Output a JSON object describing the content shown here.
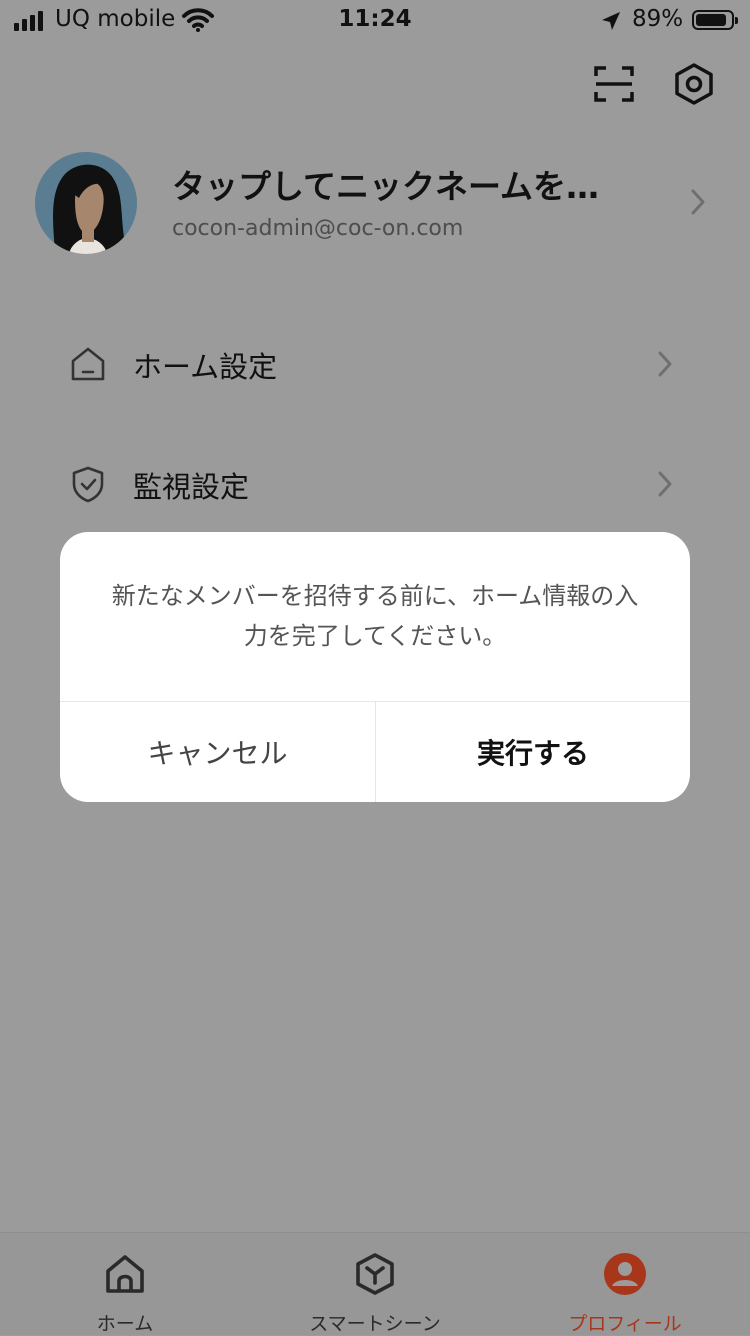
{
  "status_bar": {
    "carrier": "UQ mobile",
    "time": "11:24",
    "battery_percent": "89%",
    "battery_level": 0.89,
    "signal_bars": 4,
    "icons": [
      "signal-icon",
      "wifi-icon",
      "location-arrow-icon",
      "battery-icon"
    ]
  },
  "header": {
    "icons": [
      "scan-icon",
      "settings-gear-icon"
    ]
  },
  "profile": {
    "nickname": "タップしてニックネームを…",
    "email": "cocon-admin@coc-on.com"
  },
  "menu": {
    "items": [
      {
        "label": "ホーム設定",
        "icon": "home-outline-icon"
      },
      {
        "label": "監視設定",
        "icon": "shield-check-icon"
      }
    ]
  },
  "dialog": {
    "message": "新たなメンバーを招待する前に、ホーム情報の入力を完了してください。",
    "cancel_label": "キャンセル",
    "confirm_label": "実行する"
  },
  "tabbar": {
    "tabs": [
      {
        "label": "ホーム",
        "icon": "home-icon"
      },
      {
        "label": "スマートシーン",
        "icon": "cube-icon"
      },
      {
        "label": "プロフィール",
        "icon": "profile-icon",
        "active": true
      }
    ]
  },
  "colors": {
    "accent": "#a8361a",
    "overlay": "#9b9b9b",
    "dialog_bg": "#ffffff"
  }
}
